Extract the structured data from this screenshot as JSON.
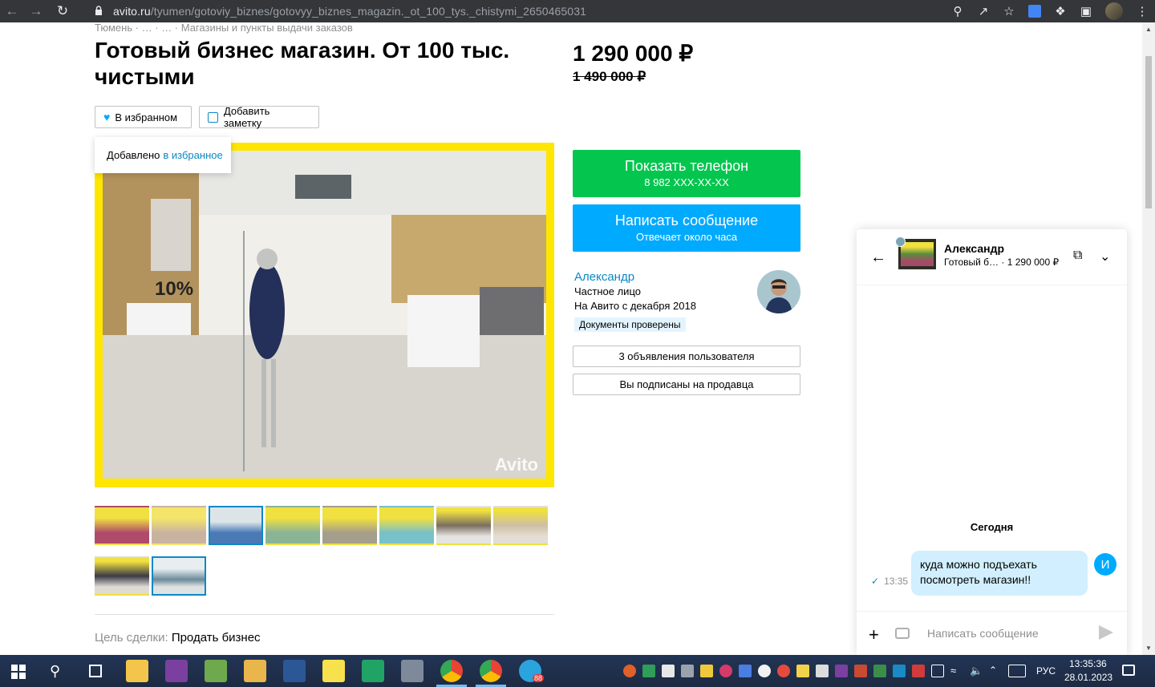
{
  "browser": {
    "url_host": "avito.ru",
    "url_path": "/tyumen/gotoviy_biznes/gotovyy_biznes_magazin._ot_100_tys._chistymi_2650465031"
  },
  "breadcrumbs": "Тюмень · … · … · Магазины и пункты выдачи заказов",
  "listing": {
    "title": "Готовый бизнес магазин. От 100 тыс. чистыми",
    "price": "1 290 000 ₽",
    "old_price": "1 490 000 ₽",
    "favorite_label": "В избранном",
    "note_label": "Добавить заметку",
    "tooltip_text": "Добавлено",
    "tooltip_link": "в избранное",
    "watermark": "Avito",
    "goal_label": "Цель сделки:",
    "goal_value": "Продать бизнес"
  },
  "actions": {
    "phone_title": "Показать телефон",
    "phone_number": "8 982 XXX-XX-XX",
    "message_title": "Написать сообщение",
    "message_sub": "Отвечает около часа"
  },
  "seller": {
    "name": "Александр",
    "type": "Частное лицо",
    "since": "На Авито с декабря 2018",
    "badge": "Документы проверены",
    "ads_button": "3 объявления пользователя",
    "subscribed_button": "Вы подписаны на продавца"
  },
  "chat": {
    "name": "Александр",
    "item_short": "Готовый б…",
    "item_price": "· 1 290 000 ₽",
    "day": "Сегодня",
    "message": "куда можно подъехать посмотреть магазин!!",
    "time": "13:35",
    "my_initial": "И",
    "input_placeholder": "Написать сообщение"
  },
  "taskbar": {
    "lang": "РУС",
    "clock_time": "13:35:36",
    "clock_date": "28.01.2023",
    "telegram_badge": "88"
  },
  "colors": {
    "green": "#04c64f",
    "blue": "#00aaff",
    "link": "#0a89c4",
    "photo_frame": "#fee600"
  }
}
